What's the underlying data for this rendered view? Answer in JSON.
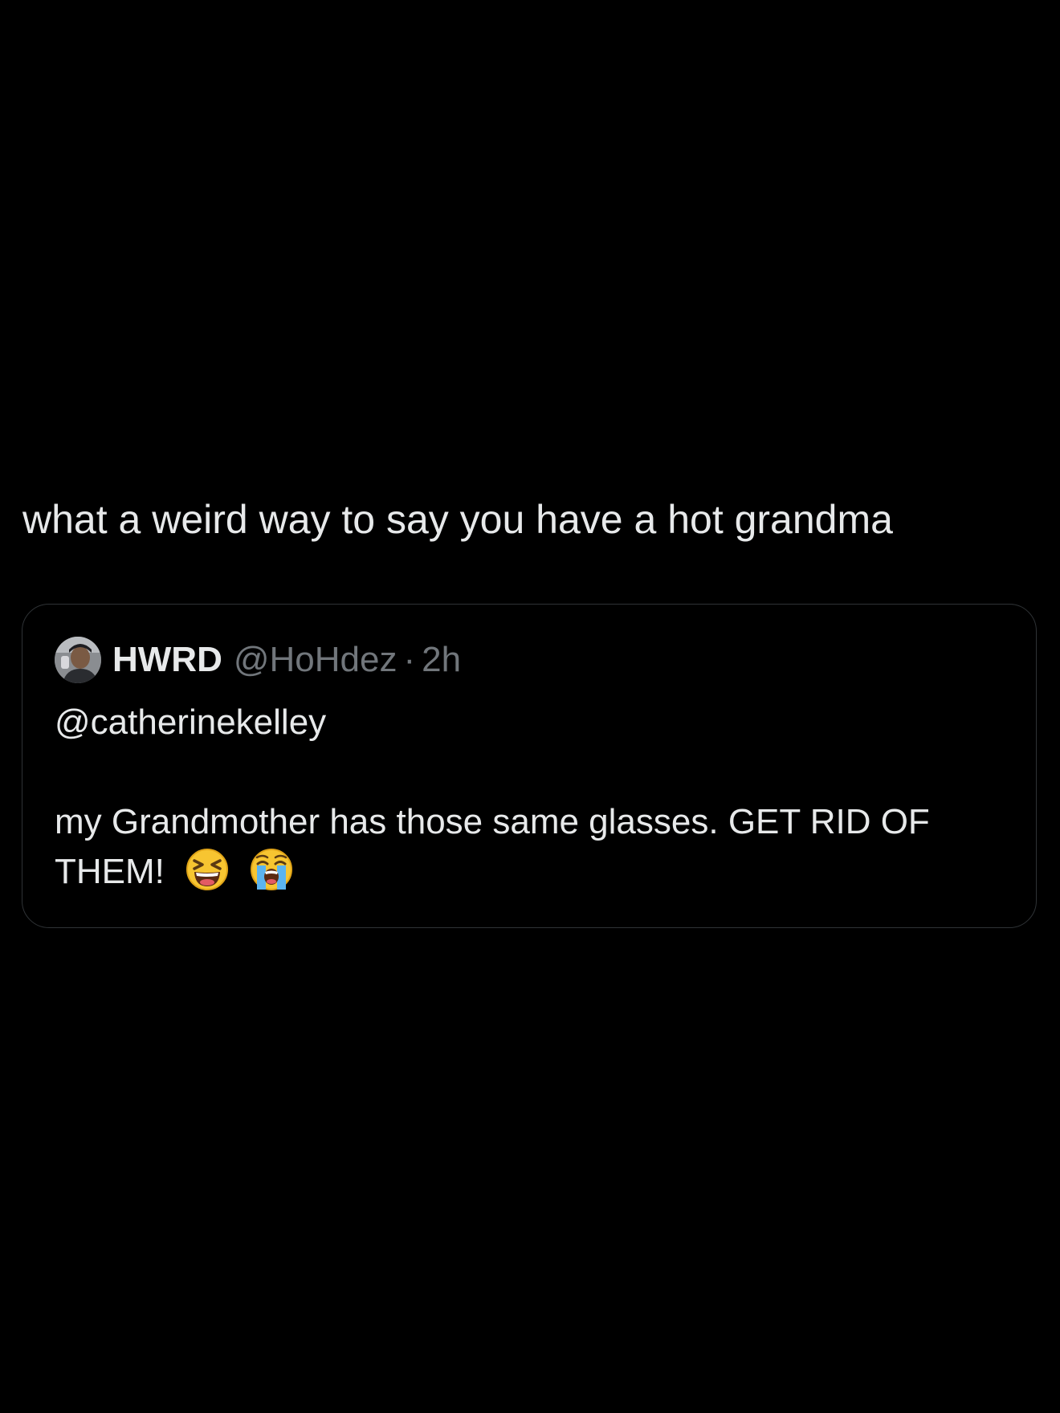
{
  "post": {
    "text": "what a weird way to say you have a hot grandma"
  },
  "quoted_post": {
    "author": {
      "display_name": "HWRD",
      "handle": "@HoHdez",
      "avatar_icon": "user-avatar"
    },
    "separator": "·",
    "timestamp": "2h",
    "mention": "@catherinekelley",
    "line1": "my Grandmother has those same glasses. GET RID OF",
    "line2": "THEM!",
    "emojis": [
      "laughing-squinting-face-emoji",
      "loudly-crying-face-emoji"
    ]
  },
  "colors": {
    "background": "#000000",
    "primary_text": "#e7e9ea",
    "secondary_text": "#71767b",
    "card_border": "#2f3336"
  }
}
